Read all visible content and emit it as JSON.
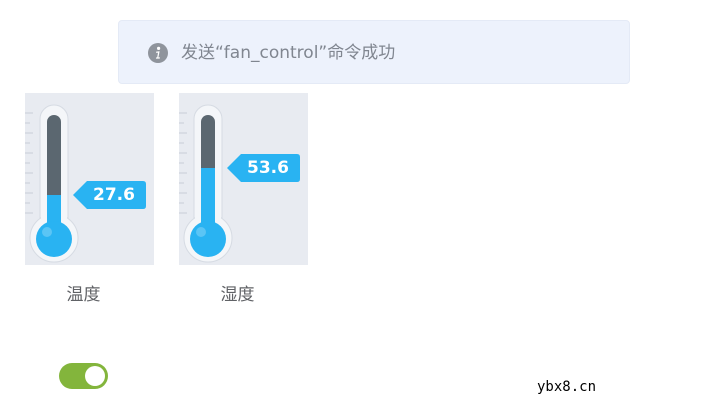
{
  "notification": {
    "message": "发送“fan_control”命令成功",
    "icon": "info-circle-icon"
  },
  "thermometers": [
    {
      "value": "27.6",
      "level": 0.28,
      "label": "温度"
    },
    {
      "value": "53.6",
      "level": 0.54,
      "label": "湿度"
    }
  ],
  "toggle": {
    "state": "on"
  },
  "watermark": "ybx8.cn",
  "colors": {
    "toast_bg": "#edf2fc",
    "mercury": "#29b3f2",
    "tube_empty": "#5b6770",
    "toggle_on": "#83b53c",
    "card_bg": "#e8ebf1"
  }
}
